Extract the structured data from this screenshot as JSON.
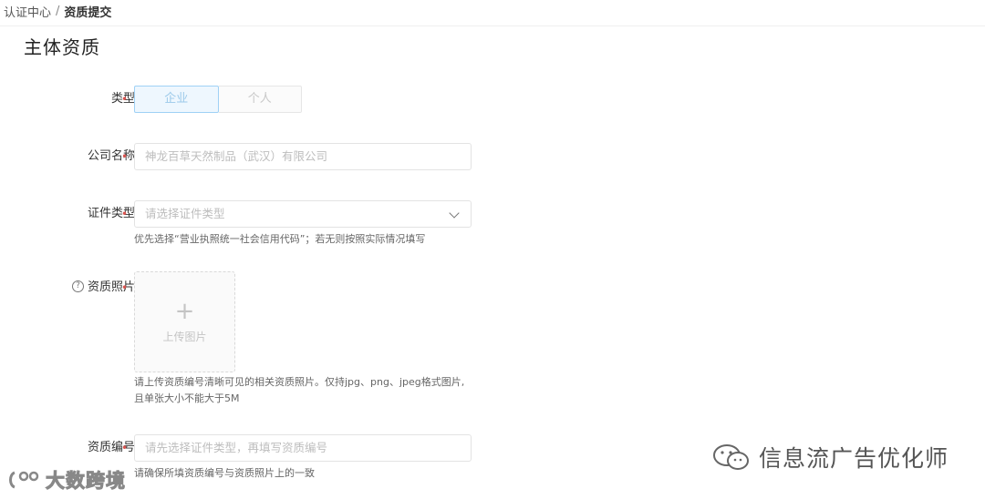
{
  "breadcrumb": {
    "parent": "认证中心",
    "separator": "/",
    "current": "资质提交"
  },
  "page": {
    "title": "主体资质"
  },
  "form": {
    "type": {
      "label": "类型",
      "options": [
        "企业",
        "个人"
      ],
      "selected": "企业"
    },
    "company_name": {
      "label": "公司名称",
      "placeholder": "神龙百草天然制品（武汉）有限公司"
    },
    "cert_type": {
      "label": "证件类型",
      "placeholder": "请选择证件类型",
      "hint": "优先选择“营业执照统一社会信用代码”；若无则按照实际情况填写"
    },
    "cert_photo": {
      "label": "资质照片",
      "help_icon": "question-circle-icon",
      "upload_label": "上传图片",
      "hint_line1": "请上传资质编号清晰可见的相关资质照片。仅持jpg、png、jpeg格式图片,",
      "hint_line2": "且单张大小不能大于5M"
    },
    "cert_number": {
      "label": "资质编号",
      "placeholder": "请先选择证件类型，再填写资质编号",
      "hint": "请确保所填资质编号与资质照片上的一致"
    }
  },
  "required_mark": "•",
  "watermarks": {
    "left": "大数跨境",
    "right": "信息流广告优化师"
  },
  "colors": {
    "required": "#d9534f",
    "active_border": "#9fd1f5",
    "active_bg": "#eef7fe"
  }
}
